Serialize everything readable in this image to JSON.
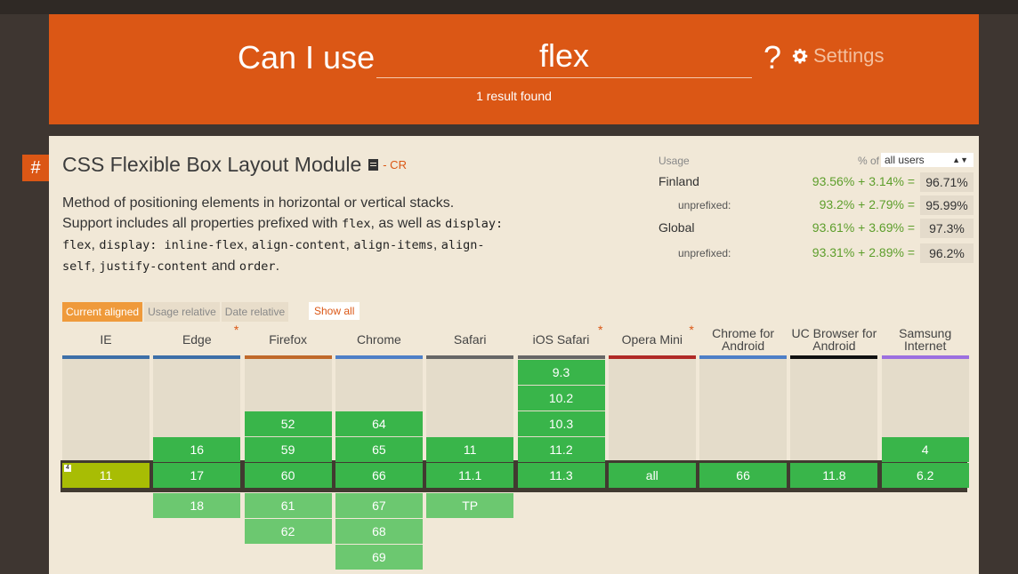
{
  "header": {
    "can_i_use": "Can I use",
    "query": "flex",
    "question_mark": "?",
    "settings_label": "Settings",
    "result_count": "1 result found"
  },
  "feature": {
    "hash": "#",
    "title": "CSS Flexible Box Layout Module",
    "status": "- CR",
    "description_parts": {
      "p1": "Method of positioning elements in horizontal or vertical stacks. Support includes all properties prefixed with ",
      "c1": "flex",
      "p2": ", as well as ",
      "c2": "display: flex",
      "p3": ", ",
      "c3": "display: inline-flex",
      "p4": ", ",
      "c4": "align-content",
      "p5": ", ",
      "c5": "align-items",
      "p6": ", ",
      "c6": "align-self",
      "p7": ", ",
      "c7": "justify-content",
      "p8": " and ",
      "c8": "order",
      "p9": "."
    }
  },
  "usage": {
    "heading": "Usage",
    "pct_of": "% of",
    "select_value": "all users",
    "rows": [
      {
        "label": "Finland",
        "calc": "93.56% + 3.14% =",
        "total": "96.71%"
      },
      {
        "label": "unprefixed:",
        "calc": "93.2%  + 2.79% =",
        "total": "95.99%"
      },
      {
        "label": "Global",
        "calc": "93.61% + 3.69% =",
        "total": "97.3%"
      },
      {
        "label": "unprefixed:",
        "calc": "93.31% + 2.89% =",
        "total": "96.2%"
      }
    ]
  },
  "tabs": {
    "current_aligned": "Current aligned",
    "usage_relative": "Usage relative",
    "date_relative": "Date relative",
    "show_all": "Show all"
  },
  "colors": {
    "header": "#db5715",
    "panel": "#f1e8d7",
    "supported": "#39b54a",
    "supported_future": "#6cc870",
    "partial": "#a8bd04",
    "empty": "#e4dcca"
  },
  "browsers": [
    {
      "name": "IE",
      "bar": "#3d6fa8",
      "star": false,
      "past": [],
      "current": "11",
      "current_partial": true,
      "note": "4",
      "future": []
    },
    {
      "name": "Edge",
      "bar": "#3d6fa8",
      "star": true,
      "past": [
        "16"
      ],
      "current": "17",
      "future": [
        "18"
      ]
    },
    {
      "name": "Firefox",
      "bar": "#c0692a",
      "star": false,
      "past": [
        "52",
        "59"
      ],
      "current": "60",
      "future": [
        "61",
        "62"
      ]
    },
    {
      "name": "Chrome",
      "bar": "#4e7fc7",
      "star": false,
      "past": [
        "64",
        "65"
      ],
      "current": "66",
      "future": [
        "67",
        "68",
        "69"
      ]
    },
    {
      "name": "Safari",
      "bar": "#666666",
      "star": false,
      "past": [
        "11"
      ],
      "current": "11.1",
      "future": [
        "TP"
      ]
    },
    {
      "name": "iOS Safari",
      "bar": "#666666",
      "star": true,
      "past": [
        "9.3",
        "10.2",
        "10.3",
        "11.2"
      ],
      "current": "11.3",
      "future": []
    },
    {
      "name": "Opera Mini",
      "bar": "#b02a26",
      "star": true,
      "past": [],
      "current": "all",
      "future": []
    },
    {
      "name": "Chrome for Android",
      "bar": "#4e7fc7",
      "star": false,
      "past": [],
      "current": "66",
      "future": []
    },
    {
      "name": "UC Browser for Android",
      "bar": "#111111",
      "star": false,
      "past": [],
      "current": "11.8",
      "future": []
    },
    {
      "name": "Samsung Internet",
      "bar": "#9c6fe0",
      "star": false,
      "past": [
        "4"
      ],
      "current": "6.2",
      "future": []
    }
  ]
}
